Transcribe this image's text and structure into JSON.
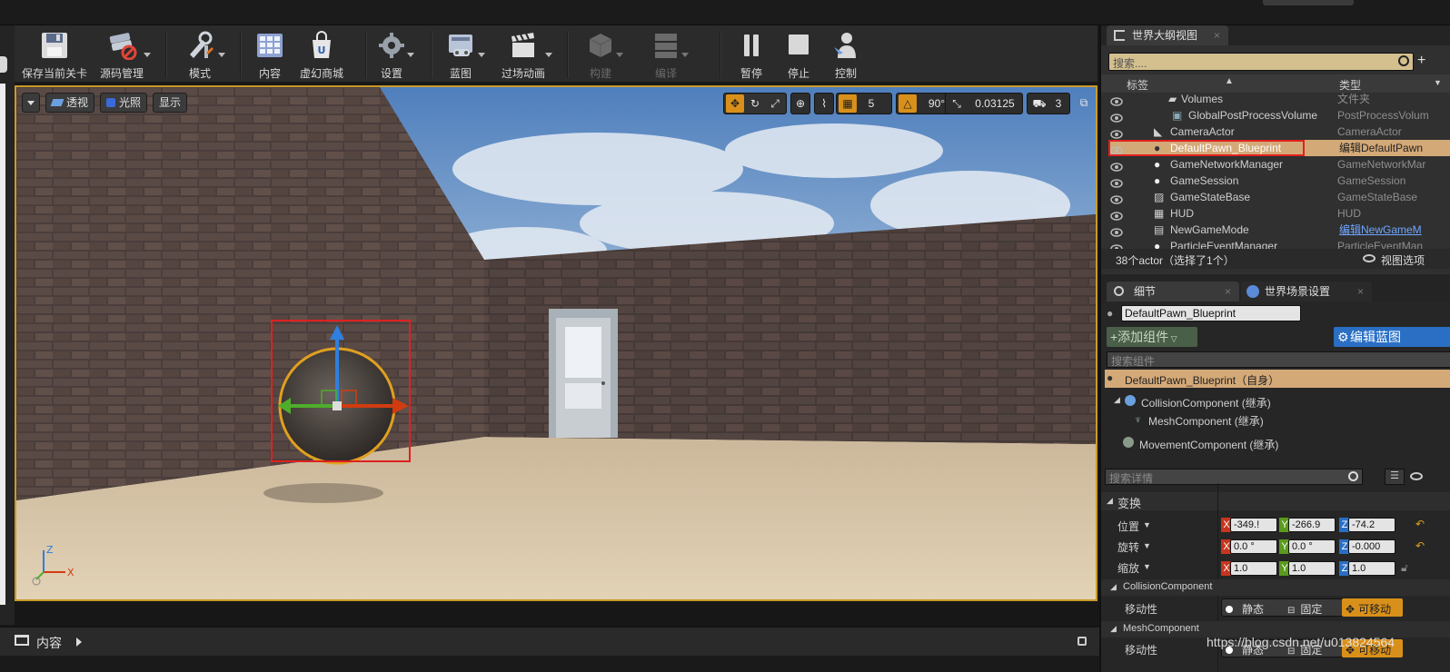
{
  "toolbar": {
    "buttons": [
      {
        "label": "保存当前关卡",
        "icon": "save-icon"
      },
      {
        "label": "源码管理",
        "icon": "source-control-icon"
      },
      {
        "label": "模式",
        "icon": "modes-icon"
      },
      {
        "label": "内容",
        "icon": "content-icon"
      },
      {
        "label": "虚幻商城",
        "icon": "marketplace-icon"
      },
      {
        "label": "设置",
        "icon": "settings-icon"
      },
      {
        "label": "蓝图",
        "icon": "blueprint-icon"
      },
      {
        "label": "过场动画",
        "icon": "cinematics-icon"
      },
      {
        "label": "构建",
        "icon": "build-icon"
      },
      {
        "label": "编译",
        "icon": "compile-icon"
      },
      {
        "label": "暂停",
        "icon": "pause-icon"
      },
      {
        "label": "停止",
        "icon": "stop-icon"
      },
      {
        "label": "控制",
        "icon": "possess-icon"
      }
    ]
  },
  "viewport": {
    "perspective_label": "透视",
    "lit_label": "光照",
    "show_label": "显示",
    "grid_snap": "5",
    "rotation_snap": "90°",
    "scale_snap": "0.03125",
    "camera_speed": "3",
    "axis_z": "Z",
    "axis_x": "X"
  },
  "content_bar": {
    "label": "内容"
  },
  "outliner": {
    "tab_title": "世界大纲视图",
    "search_placeholder": "搜索....",
    "col_label": "标签",
    "col_type": "类型",
    "rows": [
      {
        "name": "Volumes",
        "type": "文件夹"
      },
      {
        "name": "GlobalPostProcessVolume",
        "type": "PostProcessVolum"
      },
      {
        "name": "CameraActor",
        "type": "CameraActor"
      },
      {
        "name": "DefaultPawn_Blueprint",
        "type": "编辑DefaultPawn"
      },
      {
        "name": "GameNetworkManager",
        "type": "GameNetworkMar"
      },
      {
        "name": "GameSession",
        "type": "GameSession"
      },
      {
        "name": "GameStateBase",
        "type": "GameStateBase"
      },
      {
        "name": "HUD",
        "type": "HUD"
      },
      {
        "name": "NewGameMode",
        "type": "编辑NewGameM"
      },
      {
        "name": "ParticleEventManager",
        "type": "ParticleEventMan"
      }
    ],
    "status": "38个actor（选择了1个）",
    "view_options": "视图选项"
  },
  "details": {
    "tab_details": "细节",
    "tab_world": "世界场景设置",
    "name_value": "DefaultPawn_Blueprint",
    "add_component": "+添加组件",
    "edit_blueprint": "编辑蓝图",
    "search_components": "搜索组件",
    "self_item": "DefaultPawn_Blueprint（自身）",
    "components": [
      "CollisionComponent (继承)",
      "MeshComponent (继承)",
      "MovementComponent (继承)"
    ],
    "search_details": "搜索详情",
    "transform_header": "变换",
    "location_label": "位置",
    "rotation_label": "旋转",
    "scale_label": "缩放",
    "location": {
      "x": "-349.!",
      "y": "-266.9",
      "z": "-74.2"
    },
    "rotation": {
      "x": "0.0 °",
      "y": "0.0 °",
      "z": "-0.000"
    },
    "scale": {
      "x": "1.0",
      "y": "1.0",
      "z": "1.0"
    },
    "collision_header": "CollisionComponent",
    "mobility_label": "移动性",
    "mob_static": "静态",
    "mob_stationary": "固定",
    "mob_movable": "可移动",
    "mesh_header": "MeshComponent",
    "watermark": "https://blog.csdn.net/u013824564"
  },
  "colors": {
    "accent": "#c89a2a",
    "selection": "#d4a978",
    "highlight_box": "#e02020",
    "link": "#6fa6ff"
  }
}
